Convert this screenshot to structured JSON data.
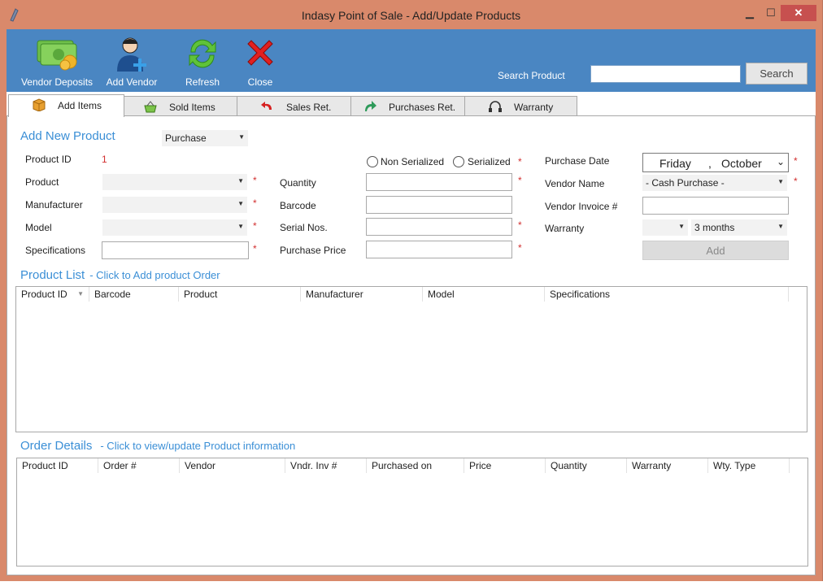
{
  "window": {
    "title": "Indasy Point of Sale - Add/Update Products"
  },
  "toolbar": {
    "buttons": [
      {
        "label": "Vendor Deposits",
        "icon": "money-icon"
      },
      {
        "label": "Add Vendor",
        "icon": "add-user-icon"
      },
      {
        "label": "Refresh",
        "icon": "refresh-icon"
      },
      {
        "label": "Close",
        "icon": "close-x-icon"
      }
    ],
    "search_label": "Search Product",
    "search_value": "",
    "search_button": "Search"
  },
  "tabs": [
    {
      "label": "Add Items",
      "icon": "box-icon",
      "active": true
    },
    {
      "label": "Sold Items",
      "icon": "basket-icon",
      "active": false
    },
    {
      "label": "Sales Ret.",
      "icon": "return-arrow-icon",
      "active": false
    },
    {
      "label": "Purchases Ret.",
      "icon": "forward-arrow-icon",
      "active": false
    },
    {
      "label": "Warranty",
      "icon": "headset-icon",
      "active": false
    }
  ],
  "form": {
    "title": "Add New Product",
    "mode_value": "Purchase",
    "product_id_label": "Product ID",
    "product_id_value": "1",
    "product_label": "Product",
    "manufacturer_label": "Manufacturer",
    "model_label": "Model",
    "specifications_label": "Specifications",
    "non_serialized_label": "Non Serialized",
    "serialized_label": "Serialized",
    "quantity_label": "Quantity",
    "barcode_label": "Barcode",
    "serial_nos_label": "Serial Nos.",
    "purchase_price_label": "Purchase Price",
    "purchase_date_label": "Purchase Date",
    "purchase_date_day": "Friday",
    "purchase_date_sep": ",",
    "purchase_date_month": "October",
    "vendor_name_label": "Vendor Name",
    "vendor_name_value": "- Cash Purchase -",
    "vendor_invoice_label": "Vendor Invoice #",
    "warranty_label": "Warranty",
    "warranty_value": "3 months",
    "add_button": "Add",
    "required_mark": "*"
  },
  "product_list": {
    "title": "Product List",
    "subtitle": "- Click to Add product Order",
    "columns": [
      "Product ID",
      "Barcode",
      "Product",
      "Manufacturer",
      "Model",
      "Specifications"
    ]
  },
  "order_details": {
    "title": "Order Details",
    "subtitle": "- Click to view/update Product information",
    "columns": [
      "Product ID",
      "Order #",
      "Vendor",
      "Vndr. Inv #",
      "Purchased on",
      "Price",
      "Quantity",
      "Warranty",
      "Wty. Type"
    ]
  },
  "colors": {
    "frame": "#d9896b",
    "toolbar": "#4a86c2",
    "accent": "#3b8fd6",
    "required": "#d23030"
  }
}
